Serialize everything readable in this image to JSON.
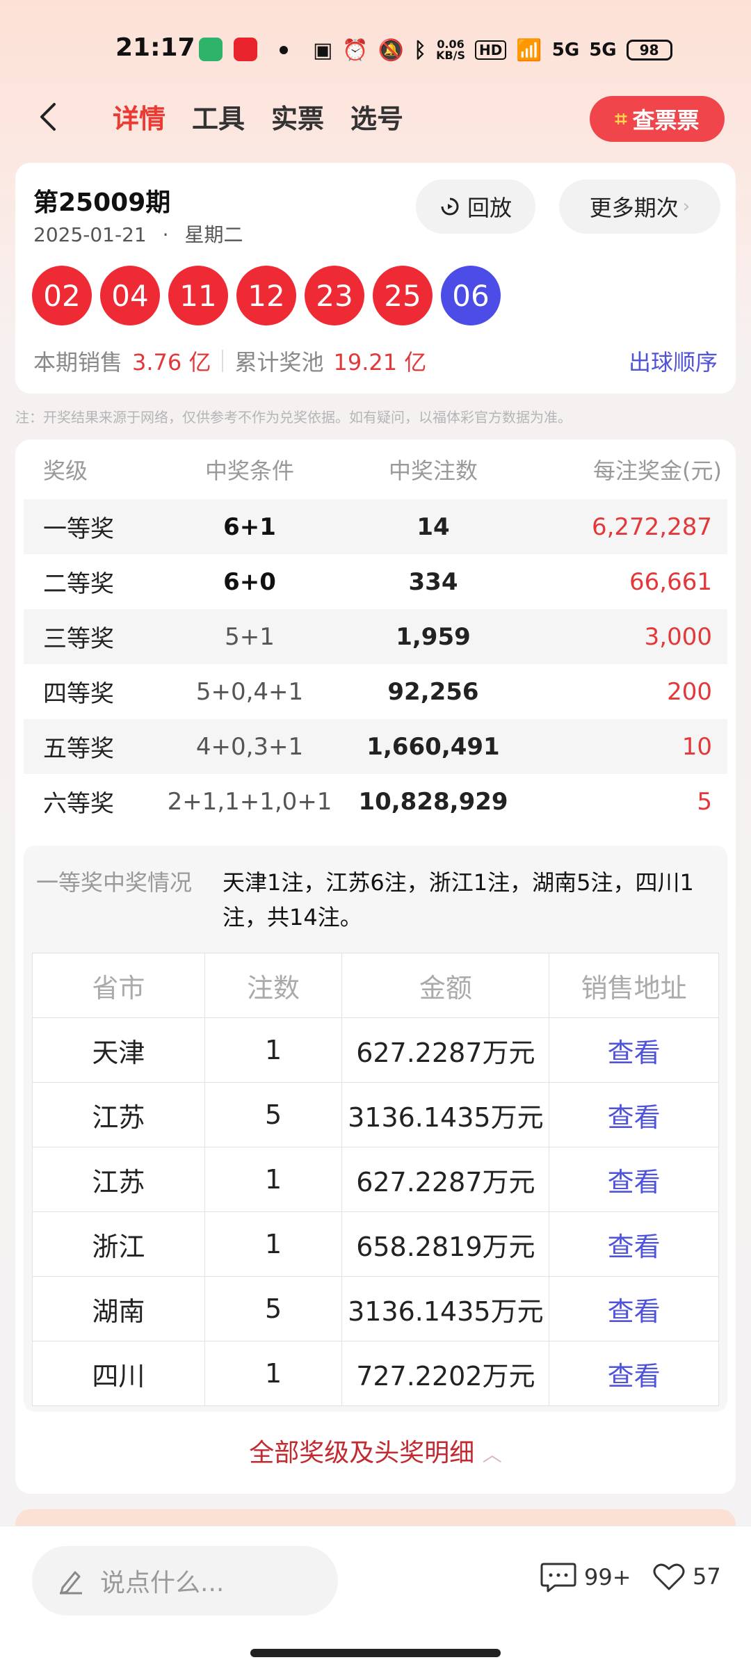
{
  "status": {
    "time": "21:17",
    "speed_top": "0.06",
    "speed_bottom": "KB/S",
    "hd": "HD",
    "net1": "5G",
    "net2": "5G",
    "battery": "98"
  },
  "nav": {
    "tabs": [
      "详情",
      "工具",
      "实票",
      "选号"
    ],
    "check_btn": "查票票"
  },
  "result": {
    "issue": "第25009期",
    "date": "2025-01-21",
    "dot": "·",
    "weekday": "星期二",
    "replay_label": "回放",
    "more_label": "更多期次",
    "red_balls": [
      "02",
      "04",
      "11",
      "12",
      "23",
      "25"
    ],
    "blue_ball": "06",
    "sales_label": "本期销售",
    "sales_value": "3.76 亿",
    "pool_label": "累计奖池",
    "pool_value": "19.21 亿",
    "order_link": "出球顺序"
  },
  "note": "注：开奖结果来源于网络，仅供参考不作为兑奖依据。如有疑问，以福体彩官方数据为准。",
  "prize": {
    "headers": [
      "奖级",
      "中奖条件",
      "中奖注数",
      "每注奖金(元)"
    ],
    "rows": [
      {
        "level": "一等奖",
        "cond": "6+1",
        "count": "14",
        "amount": "6,272,287"
      },
      {
        "level": "二等奖",
        "cond": "6+0",
        "count": "334",
        "amount": "66,661"
      },
      {
        "level": "三等奖",
        "cond": "5+1",
        "count": "1,959",
        "amount": "3,000"
      },
      {
        "level": "四等奖",
        "cond": "5+0,4+1",
        "count": "92,256",
        "amount": "200"
      },
      {
        "level": "五等奖",
        "cond": "4+0,3+1",
        "count": "1,660,491",
        "amount": "10"
      },
      {
        "level": "六等奖",
        "cond": "2+1,1+1,0+1",
        "count": "10,828,929",
        "amount": "5"
      }
    ]
  },
  "first_prize": {
    "label": "一等奖中奖情况",
    "text": "天津1注，江苏6注，浙江1注，湖南5注，四川1注，共14注。",
    "headers": [
      "省市",
      "注数",
      "金额",
      "销售地址"
    ],
    "rows": [
      {
        "region": "天津",
        "count": "1",
        "amount": "627.2287万元",
        "link": "查看"
      },
      {
        "region": "江苏",
        "count": "5",
        "amount": "3136.1435万元",
        "link": "查看"
      },
      {
        "region": "江苏",
        "count": "1",
        "amount": "627.2287万元",
        "link": "查看"
      },
      {
        "region": "浙江",
        "count": "1",
        "amount": "658.2819万元",
        "link": "查看"
      },
      {
        "region": "湖南",
        "count": "5",
        "amount": "3136.1435万元",
        "link": "查看"
      },
      {
        "region": "四川",
        "count": "1",
        "amount": "727.2202万元",
        "link": "查看"
      }
    ],
    "all_link": "全部奖级及头奖明细"
  },
  "bottom": {
    "placeholder": "说点什么...",
    "comments": "99+",
    "likes": "57"
  },
  "colors": {
    "red": "#ee2b35",
    "blue": "#4b4de6",
    "accent": "#ea3a32",
    "link": "#4e53d9"
  }
}
